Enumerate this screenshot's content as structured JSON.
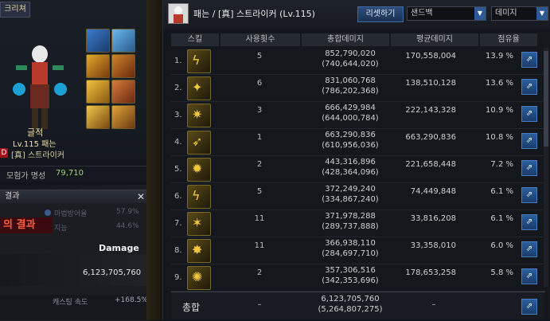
{
  "left_panel": {
    "tab_label": "크리쳐",
    "char_name": "글적",
    "char_level": "Lv.115 패는",
    "char_class": "[真] 스트라이커",
    "class_badge": "D",
    "fame_label": "모험가 명성",
    "fame_value": "79,710"
  },
  "result_window": {
    "header": "결과",
    "title": "의 결과",
    "damage_label": "Damage",
    "damage_value": "6,123,705,760",
    "faint_stats": [
      "마법방어율",
      "57.9%",
      "지능",
      "44.6%"
    ],
    "bottom_stat": "캐스팅 속도",
    "bottom_value": "+168.5%"
  },
  "stats_panel": {
    "title": "패는 / [真] 스트라이커 (Lv.115)",
    "reset_button": "리셋하기",
    "target_select": "샌드백",
    "mode_select": "데미지",
    "columns": [
      "스킬",
      "사용횟수",
      "총합데미지",
      "평균데미지",
      "점유율"
    ],
    "rows": [
      {
        "num": "1.",
        "uses": "5",
        "total": "852,790,020",
        "total_sub": "(740,644,020)",
        "avg": "170,558,004",
        "share": "13.9 %"
      },
      {
        "num": "2.",
        "uses": "6",
        "total": "831,060,768",
        "total_sub": "(786,202,368)",
        "avg": "138,510,128",
        "share": "13.6 %"
      },
      {
        "num": "3.",
        "uses": "3",
        "total": "666,429,984",
        "total_sub": "(644,000,784)",
        "avg": "222,143,328",
        "share": "10.9 %"
      },
      {
        "num": "4.",
        "uses": "1",
        "total": "663,290,836",
        "total_sub": "(610,956,036)",
        "avg": "663,290,836",
        "share": "10.8 %"
      },
      {
        "num": "5.",
        "uses": "2",
        "total": "443,316,896",
        "total_sub": "(428,364,096)",
        "avg": "221,658,448",
        "share": "7.2 %"
      },
      {
        "num": "6.",
        "uses": "5",
        "total": "372,249,240",
        "total_sub": "(334,867,240)",
        "avg": "74,449,848",
        "share": "6.1 %"
      },
      {
        "num": "7.",
        "uses": "11",
        "total": "371,978,288",
        "total_sub": "(289,737,888)",
        "avg": "33,816,208",
        "share": "6.1 %"
      },
      {
        "num": "8.",
        "uses": "11",
        "total": "366,938,110",
        "total_sub": "(284,697,710)",
        "avg": "33,358,010",
        "share": "6.0 %"
      },
      {
        "num": "9.",
        "uses": "2",
        "total": "357,306,516",
        "total_sub": "(342,353,696)",
        "avg": "178,653,258",
        "share": "5.8 %"
      }
    ],
    "total_row": {
      "label": "총합",
      "uses": "–",
      "total": "6,123,705,760",
      "total_sub": "(5,264,807,275)",
      "avg": "–"
    }
  }
}
